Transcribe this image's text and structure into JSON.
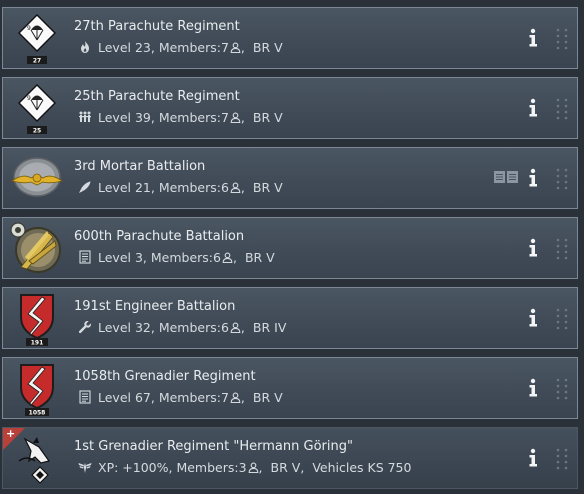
{
  "regiments": [
    {
      "name": "27th Parachute Regiment",
      "emblem": "parachute-diamond-icon",
      "emblem_tag": "27",
      "meta_icon": "flame-icon",
      "level_text": "Level 23, Members:7",
      "br_text": "BR V",
      "extra_text": ""
    },
    {
      "name": "25th Parachute Regiment",
      "emblem": "parachute-diamond-icon",
      "emblem_tag": "25",
      "meta_icon": "infantry-squad-icon",
      "level_text": "Level 39, Members:7",
      "br_text": "BR V",
      "extra_text": ""
    },
    {
      "name": "3rd Mortar Battalion",
      "emblem": "winged-eagle-badge-icon",
      "emblem_tag": "",
      "meta_icon": "mortar-shell-icon",
      "level_text": "Level 21, Members:6",
      "br_text": "BR V",
      "extra_text": ""
    },
    {
      "name": "600th Parachute Battalion",
      "emblem": "diving-eagle-wreath-icon",
      "emblem_tag": "",
      "meta_icon": "list-document-icon",
      "level_text": "Level 3, Members:6",
      "br_text": "BR V",
      "extra_text": ""
    },
    {
      "name": "191st Engineer Battalion",
      "emblem": "red-shield-lightning-icon",
      "emblem_tag": "191",
      "meta_icon": "wrench-icon",
      "level_text": "Level 32, Members:6",
      "br_text": "BR IV",
      "extra_text": ""
    },
    {
      "name": "1058th Grenadier Regiment",
      "emblem": "red-shield-lightning-icon",
      "emblem_tag": "1058",
      "meta_icon": "list-document-icon",
      "level_text": "Level 67, Members:7",
      "br_text": "BR V",
      "extra_text": ""
    },
    {
      "name": "1st Grenadier Regiment \"Hermann Göring\"",
      "emblem": "eagle-diamond-emblem-icon",
      "emblem_tag": "",
      "meta_icon": "winged-emblem-icon",
      "level_text": "XP: +100%, Members:3",
      "br_text": "BR V",
      "extra_text": "Vehicles KS 750"
    }
  ],
  "colors": {
    "background": "#2b3139",
    "row": "#404b57",
    "row_border": "#7c8896",
    "shield_red": "#c62b2b",
    "corner_badge": "#b8413a"
  }
}
